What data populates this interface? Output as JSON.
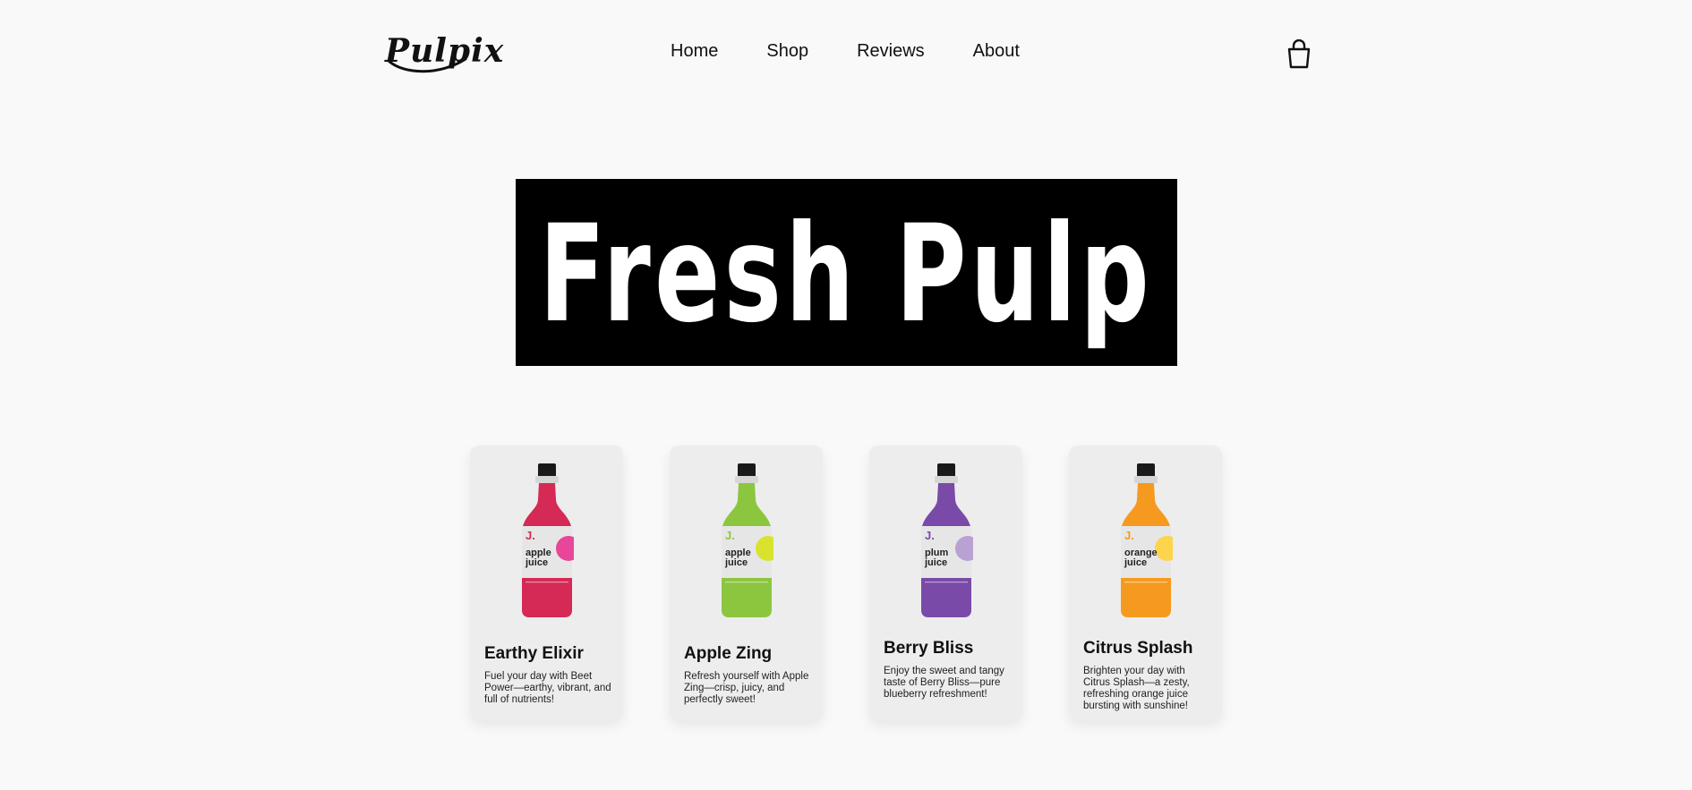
{
  "header": {
    "logo": "Pulpix",
    "nav": [
      "Home",
      "Shop",
      "Reviews",
      "About"
    ]
  },
  "hero": {
    "title": "Fresh Pulp"
  },
  "products": [
    {
      "name": "Earthy Elixir",
      "description": "Fuel your day with Beet Power—earthy, vibrant, and full of nutrients!",
      "label_top": "apple",
      "label_bottom": "juice",
      "color": "#d42a55",
      "accent": "#e8348f"
    },
    {
      "name": "Apple Zing",
      "description": "Refresh yourself with Apple Zing—crisp, juicy, and perfectly sweet!",
      "label_top": "apple",
      "label_bottom": "juice",
      "color": "#8cc63f",
      "accent": "#d7e21a"
    },
    {
      "name": "Berry Bliss",
      "description": "Enjoy the sweet and tangy taste of Berry Bliss—pure blueberry refreshment!",
      "label_top": "plum",
      "label_bottom": "juice",
      "color": "#7a4aa8",
      "accent": "#b49ad0"
    },
    {
      "name": "Citrus Splash",
      "description": "Brighten your day with Citrus Splash—a zesty, refreshing orange juice bursting with sunshine!",
      "label_top": "orange",
      "label_bottom": "juice",
      "color": "#f59a1f",
      "accent": "#ffd23a"
    }
  ]
}
